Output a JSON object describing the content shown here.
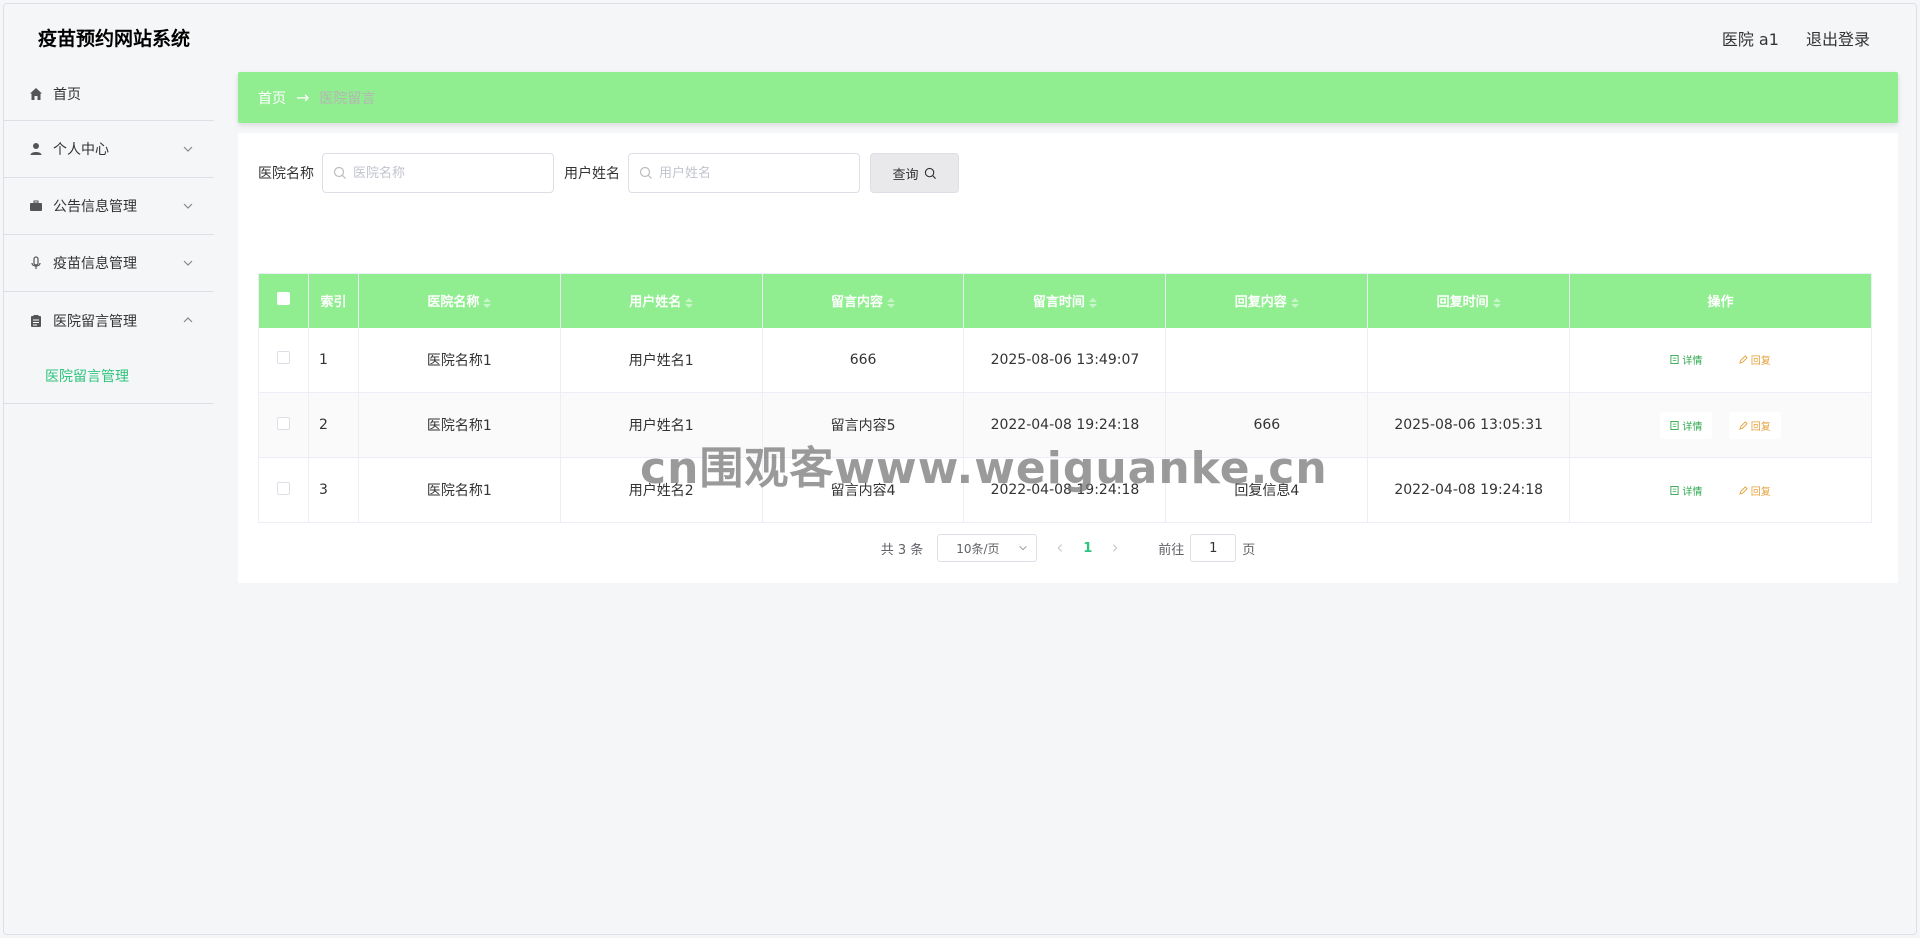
{
  "header": {
    "title": "疫苗预约网站系统",
    "user": "医院 a1",
    "logout": "退出登录"
  },
  "sidebar": {
    "items": [
      {
        "label": "首页",
        "icon": "home-icon"
      },
      {
        "label": "个人中心",
        "icon": "user-icon"
      },
      {
        "label": "公告信息管理",
        "icon": "briefcase-icon"
      },
      {
        "label": "疫苗信息管理",
        "icon": "microphone-icon"
      },
      {
        "label": "医院留言管理",
        "icon": "clipboard-icon"
      }
    ],
    "active_sub": "医院留言管理"
  },
  "breadcrumb": {
    "home": "首页",
    "separator": "→",
    "current": "医院留言"
  },
  "search": {
    "hospital_label": "医院名称",
    "hospital_placeholder": "医院名称",
    "user_label": "用户姓名",
    "user_placeholder": "用户姓名",
    "query_button": "查询"
  },
  "table": {
    "columns": [
      "索引",
      "医院名称",
      "用户姓名",
      "留言内容",
      "留言时间",
      "回复内容",
      "回复时间",
      "操作"
    ],
    "rows": [
      {
        "index": "1",
        "hospital": "医院名称1",
        "user": "用户姓名1",
        "content": "666",
        "time": "2025-08-06 13:49:07",
        "reply": "",
        "reply_time": ""
      },
      {
        "index": "2",
        "hospital": "医院名称1",
        "user": "用户姓名1",
        "content": "留言内容5",
        "time": "2022-04-08 19:24:18",
        "reply": "666",
        "reply_time": "2025-08-06 13:05:31"
      },
      {
        "index": "3",
        "hospital": "医院名称1",
        "user": "用户姓名2",
        "content": "留言内容4",
        "time": "2022-04-08 19:24:18",
        "reply": "回复信息4",
        "reply_time": "2022-04-08 19:24:18"
      }
    ],
    "detail_label": "详情",
    "reply_label": "回复"
  },
  "pager": {
    "total": "共 3 条",
    "page_size": "10条/页",
    "current_page": "1",
    "goto_label": "前往",
    "goto_value": "1",
    "page_suffix": "页"
  },
  "colors": {
    "accent_green": "#90ee90",
    "active_text": "#2fc47d",
    "detail": "#2fa84f",
    "reply": "#e6a23c"
  },
  "watermark": "cn围观客www.weiguanke.cn"
}
